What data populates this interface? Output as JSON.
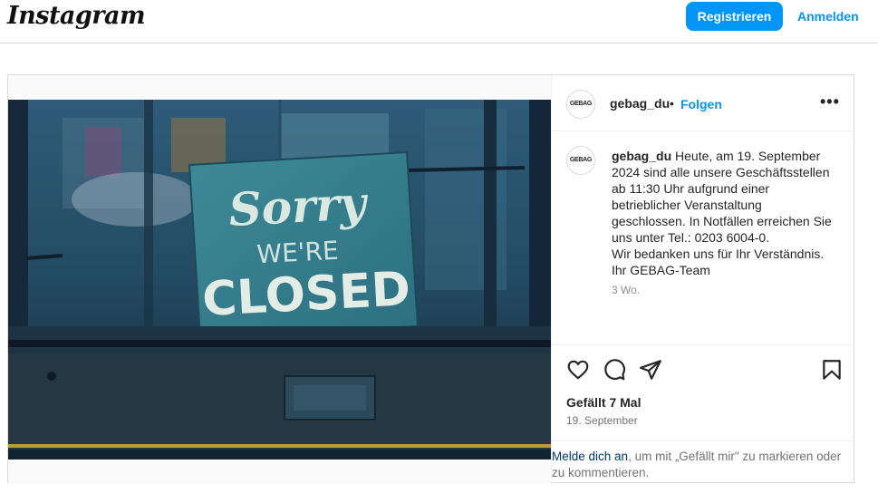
{
  "header": {
    "logo": "Instagram",
    "register_label": "Registrieren",
    "login_label": "Anmelden"
  },
  "post": {
    "avatar_text": "GEBAG",
    "username": "gebag_du",
    "dot": "•",
    "follow_label": "Folgen",
    "more_label": "•••",
    "image": {
      "sign_line1": "Sorry",
      "sign_line2": "WE'RE",
      "sign_line3": "CLOSED"
    },
    "caption": {
      "username": "gebag_du",
      "text": " Heute, am 19. September 2024 sind alle unsere Geschäftsstellen ab 11:30 Uhr aufgrund einer betrieblicher Veranstaltung geschlossen. In Notfällen erreichen Sie uns unter Tel.: 0203 6004-0.",
      "line2": "Wir bedanken uns für Ihr Verständnis.",
      "line3": "Ihr GEBAG-Team",
      "time": "3 Wo."
    },
    "likes": "Gefällt 7 Mal",
    "date": "19. September",
    "login_prompt": {
      "link": "Melde dich an",
      "text": ", um mit „Gefällt mir\" zu markieren oder zu kommentieren."
    }
  },
  "colors": {
    "accent": "#0095f6",
    "link_dark": "#00376b",
    "border": "#dbdbdb",
    "muted": "#737373"
  }
}
